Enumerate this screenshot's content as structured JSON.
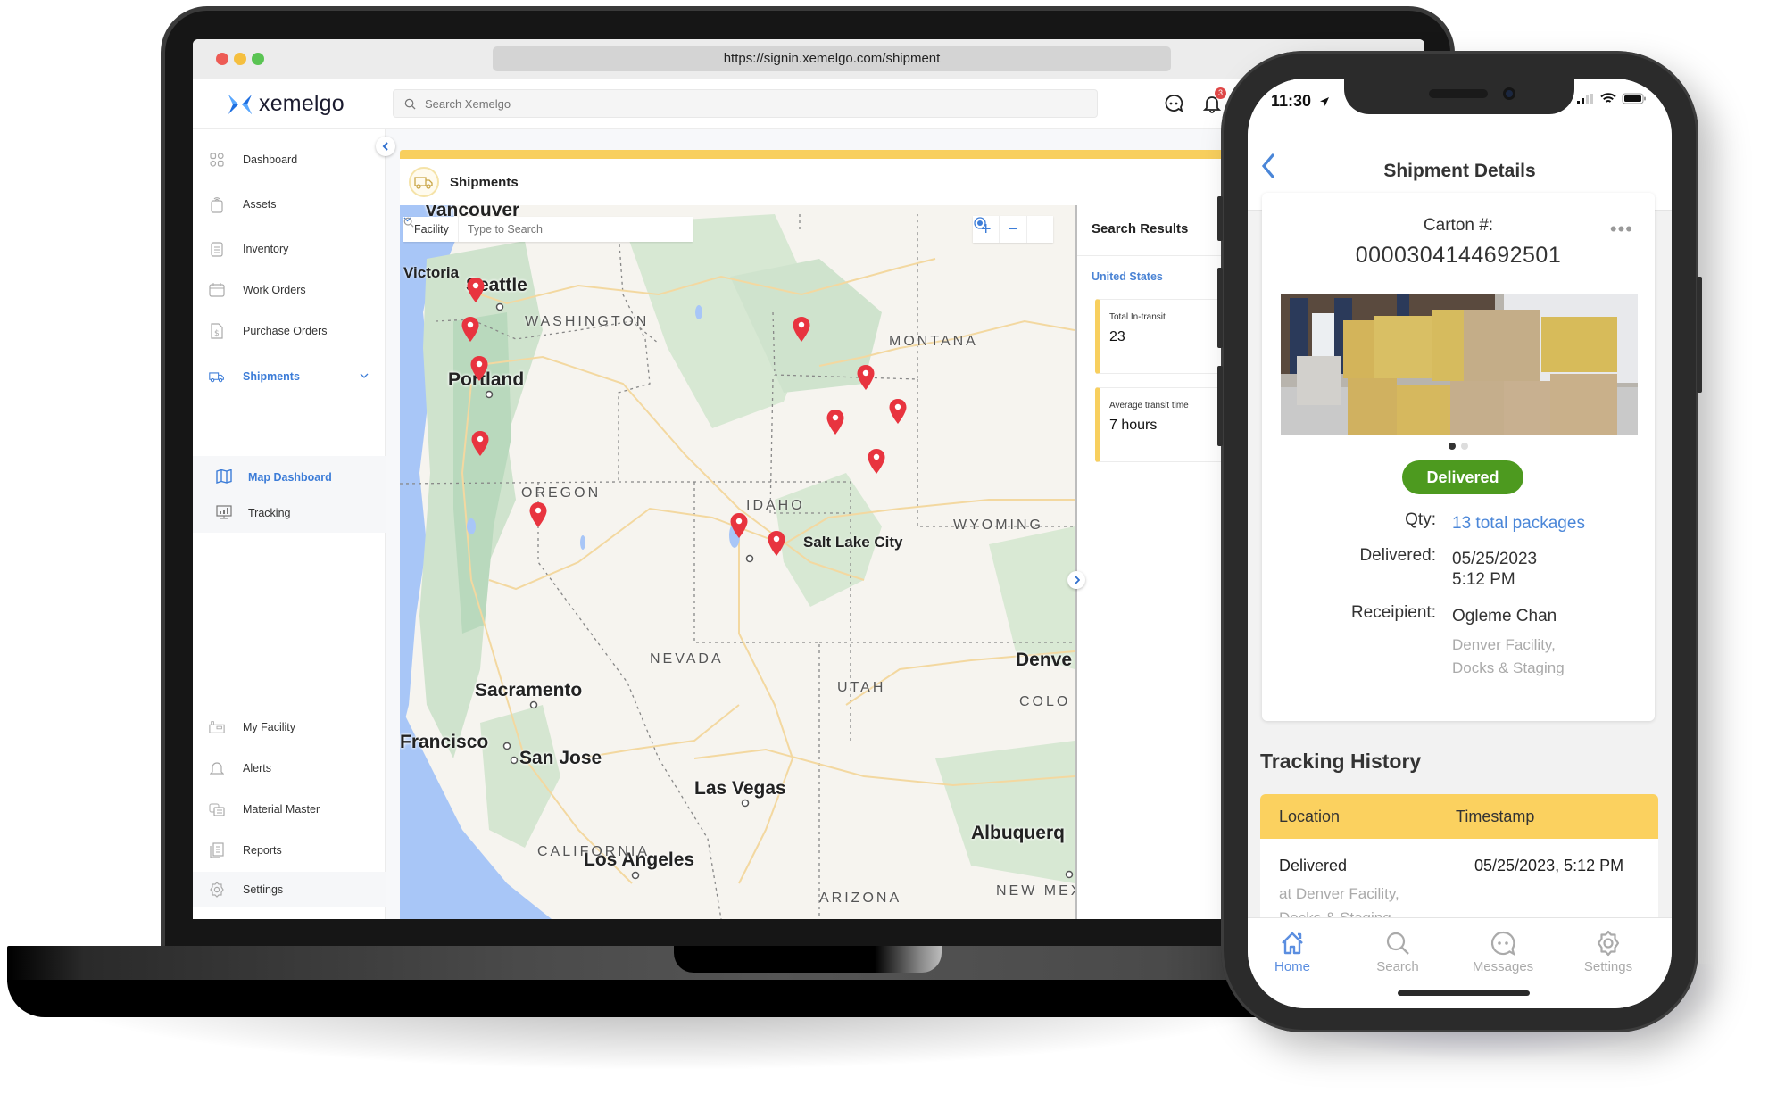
{
  "browser": {
    "url": "https://signin.xemelgo.com/shipment"
  },
  "app": {
    "brand": "xemelgo",
    "search_placeholder": "Search Xemelgo",
    "notification_count": "3",
    "accent_color": "#3d7dd8",
    "highlight_color": "#f8cf5e"
  },
  "sidebar": {
    "items": [
      {
        "label": "Dashboard",
        "icon": "dashboard-grid-icon"
      },
      {
        "label": "Assets",
        "icon": "asset-tag-icon"
      },
      {
        "label": "Inventory",
        "icon": "clipboard-icon"
      },
      {
        "label": "Work Orders",
        "icon": "calendar-icon"
      },
      {
        "label": "Purchase Orders",
        "icon": "invoice-icon"
      },
      {
        "label": "Shipments",
        "icon": "truck-icon",
        "active": true
      }
    ],
    "sub_items": [
      {
        "label": "Map Dashboard",
        "icon": "map-icon",
        "active": true
      },
      {
        "label": "Tracking",
        "icon": "monitor-chart-icon"
      }
    ],
    "bottom_items": [
      {
        "label": "My Facility",
        "icon": "facility-icon"
      },
      {
        "label": "Alerts",
        "icon": "bell-icon"
      },
      {
        "label": "Material Master",
        "icon": "material-icon"
      },
      {
        "label": "Reports",
        "icon": "reports-icon"
      },
      {
        "label": "Settings",
        "icon": "gear-icon"
      }
    ]
  },
  "main": {
    "module_title": "Shipments",
    "map": {
      "filter_select": "Facility",
      "filter_placeholder": "Type to Search",
      "zoom_in": "+",
      "zoom_out": "−",
      "cities": [
        "Vancouver",
        "Victoria",
        "Seattle",
        "Portland",
        "Sacramento",
        "Francisco",
        "San Jose",
        "Salt Lake City",
        "Las Vegas",
        "Los Angeles",
        "Denve",
        "Albuquerq"
      ],
      "states": [
        "WASHINGTON",
        "OREGON",
        "IDAHO",
        "MONTANA",
        "WYOMING",
        "NEVADA",
        "UTAH",
        "CALIFORNIA",
        "ARIZONA",
        "COLO",
        "NEW MEX"
      ],
      "pin_count": 14
    },
    "results": {
      "title": "Search Results",
      "region": "United States",
      "stats": [
        {
          "label": "Total In-transit",
          "value": "23"
        },
        {
          "label": "Average transit time",
          "value": "7 hours"
        }
      ]
    }
  },
  "phone": {
    "time": "11:30",
    "title": "Shipment Details",
    "carton_label": "Carton #:",
    "carton_number": "0000304144692501",
    "more": "•••",
    "status": "Delivered",
    "status_color": "#4d9a1f",
    "qty_label": "Qty:",
    "qty_value": "13 total packages",
    "delivered_label": "Delivered:",
    "delivered_date": "05/25/2023",
    "delivered_time": "5:12 PM",
    "recipient_label": "Receipient:",
    "recipient_name": "Ogleme Chan",
    "recipient_loc1": "Denver Facility,",
    "recipient_loc2": "Docks & Staging",
    "history": {
      "title": "Tracking History",
      "columns": [
        "Location",
        "Timestamp"
      ],
      "rows": [
        {
          "location": "Delivered",
          "sub1": "at Denver Facility,",
          "sub2": "Docks & Staging",
          "timestamp": "05/25/2023, 5:12 PM"
        }
      ]
    },
    "tabs": [
      {
        "label": "Home",
        "active": true
      },
      {
        "label": "Search"
      },
      {
        "label": "Messages"
      },
      {
        "label": "Settings"
      }
    ]
  }
}
